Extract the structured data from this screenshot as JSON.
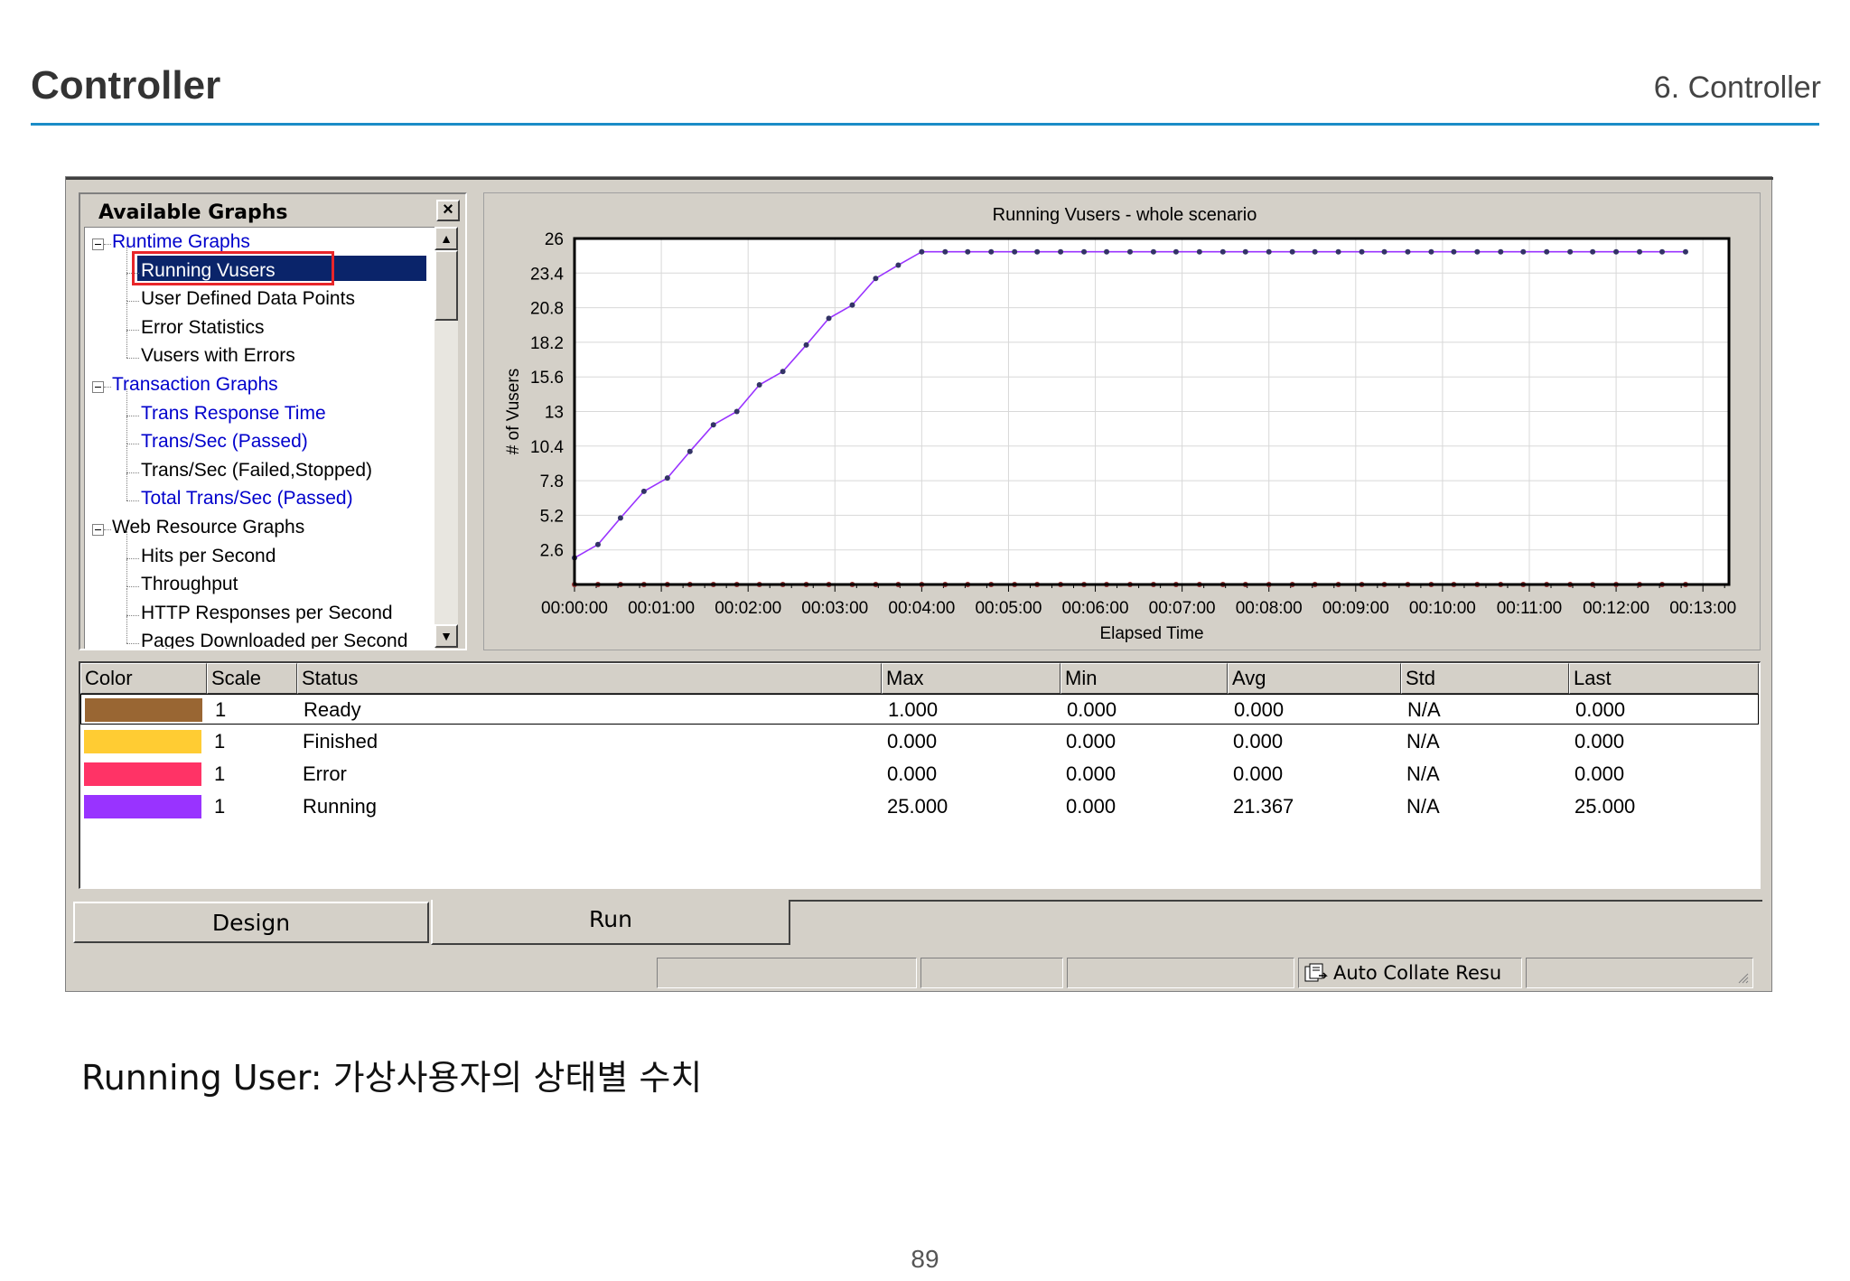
{
  "slide": {
    "title": "Controller",
    "section": "6. Controller",
    "caption": "Running User: 가상사용자의 상태별 수치",
    "page_number": "89"
  },
  "panel": {
    "title": "Available Graphs",
    "close_label": "×",
    "tree": [
      {
        "label": "Runtime Graphs",
        "level": 0,
        "link": true
      },
      {
        "label": "Running Vusers",
        "level": 1,
        "selected": true
      },
      {
        "label": "User Defined Data Points",
        "level": 1
      },
      {
        "label": "Error Statistics",
        "level": 1
      },
      {
        "label": "Vusers with Errors",
        "level": 1
      },
      {
        "label": "Transaction Graphs",
        "level": 0,
        "link": true
      },
      {
        "label": "Trans Response Time",
        "level": 1,
        "link": true
      },
      {
        "label": "Trans/Sec (Passed)",
        "level": 1,
        "link": true
      },
      {
        "label": "Trans/Sec (Failed,Stopped)",
        "level": 1
      },
      {
        "label": "Total Trans/Sec (Passed)",
        "level": 1,
        "link": true
      },
      {
        "label": "Web Resource Graphs",
        "level": 0
      },
      {
        "label": "Hits per Second",
        "level": 1
      },
      {
        "label": "Throughput",
        "level": 1
      },
      {
        "label": "HTTP Responses per Second",
        "level": 1
      },
      {
        "label": "Pages Downloaded per Second",
        "level": 1
      }
    ]
  },
  "chart_data": {
    "type": "line",
    "title": "Running Vusers - whole scenario",
    "xlabel": "Elapsed Time",
    "ylabel": "# of Vusers",
    "yticks": [
      "26",
      "23.4",
      "20.8",
      "18.2",
      "15.6",
      "13",
      "10.4",
      "7.8",
      "5.2",
      "2.6"
    ],
    "ylim": [
      0,
      26
    ],
    "xticks": [
      "00:00:00",
      "00:01:00",
      "00:02:00",
      "00:03:00",
      "00:04:00",
      "00:05:00",
      "00:06:00",
      "00:07:00",
      "00:08:00",
      "00:09:00",
      "00:10:00",
      "00:11:00",
      "00:12:00",
      "00:13:00"
    ],
    "xlim_minutes": [
      0,
      13.3
    ],
    "grid": true,
    "series": [
      {
        "name": "Running",
        "color": "#9933ff",
        "x_minutes": [
          0,
          0.27,
          0.53,
          0.8,
          1.07,
          1.33,
          1.6,
          1.87,
          2.13,
          2.4,
          2.67,
          2.93,
          3.2,
          3.47,
          3.73,
          4.0,
          4.27,
          4.53,
          4.8,
          5.07,
          5.33,
          5.6,
          5.87,
          6.13,
          6.4,
          6.67,
          6.93,
          7.2,
          7.47,
          7.73,
          8.0,
          8.27,
          8.53,
          8.8,
          9.07,
          9.33,
          9.6,
          9.87,
          10.13,
          10.4,
          10.67,
          10.93,
          11.2,
          11.47,
          11.73,
          12.0,
          12.27,
          12.53,
          12.8
        ],
        "values": [
          2,
          3,
          5,
          7,
          8,
          10,
          12,
          13,
          15,
          16,
          18,
          20,
          21,
          23,
          24,
          25,
          25,
          25,
          25,
          25,
          25,
          25,
          25,
          25,
          25,
          25,
          25,
          25,
          25,
          25,
          25,
          25,
          25,
          25,
          25,
          25,
          25,
          25,
          25,
          25,
          25,
          25,
          25,
          25,
          25,
          25,
          25,
          25,
          25
        ]
      },
      {
        "name": "Ready",
        "color": "#993333",
        "x_minutes": [
          0,
          0.27,
          0.53,
          0.8,
          1.07,
          1.33,
          1.6,
          1.87,
          2.13,
          2.4,
          2.67,
          2.93,
          3.2,
          3.47,
          3.73,
          4.0,
          4.27,
          4.53,
          4.8,
          5.07,
          5.33,
          5.6,
          5.87,
          6.13,
          6.4,
          6.67,
          6.93,
          7.2,
          7.47,
          7.73,
          8.0,
          8.27,
          8.53,
          8.8,
          9.07,
          9.33,
          9.6,
          9.87,
          10.13,
          10.4,
          10.67,
          10.93,
          11.2,
          11.47,
          11.73,
          12.0,
          12.27,
          12.53,
          12.8
        ],
        "values": [
          0,
          0,
          0,
          0,
          0,
          0,
          0,
          0,
          0,
          0,
          0,
          0,
          0,
          0,
          0,
          0,
          0,
          0,
          0,
          0,
          0,
          0,
          0,
          0,
          0,
          0,
          0,
          0,
          0,
          0,
          0,
          0,
          0,
          0,
          0,
          0,
          0,
          0,
          0,
          0,
          0,
          0,
          0,
          0,
          0,
          0,
          0,
          0,
          0
        ]
      }
    ]
  },
  "legend": {
    "headers": [
      "Color",
      "Scale",
      "Status",
      "Max",
      "Min",
      "Avg",
      "Std",
      "Last"
    ],
    "rows": [
      {
        "color": "#996633",
        "scale": "1",
        "status": "Ready",
        "max": "1.000",
        "min": "0.000",
        "avg": "0.000",
        "std": "N/A",
        "last": "0.000"
      },
      {
        "color": "#ffcc33",
        "scale": "1",
        "status": "Finished",
        "max": "0.000",
        "min": "0.000",
        "avg": "0.000",
        "std": "N/A",
        "last": "0.000"
      },
      {
        "color": "#ff3366",
        "scale": "1",
        "status": "Error",
        "max": "0.000",
        "min": "0.000",
        "avg": "0.000",
        "std": "N/A",
        "last": "0.000"
      },
      {
        "color": "#9933ff",
        "scale": "1",
        "status": "Running",
        "max": "25.000",
        "min": "0.000",
        "avg": "21.367",
        "std": "N/A",
        "last": "25.000"
      }
    ]
  },
  "tabs": {
    "design": "Design",
    "run": "Run"
  },
  "statusbar": {
    "auto_collate": "Auto Collate Resu"
  },
  "icons": {
    "close": "close-icon",
    "scroll_up": "scroll-up-arrow-icon",
    "scroll_down": "scroll-down-arrow-icon",
    "collate": "collate-results-icon",
    "grip": "resize-grip-icon"
  },
  "colors": {
    "accent_rule": "#1a8cc7",
    "selection": "#0a246a",
    "highlight_box": "#e8262a"
  }
}
